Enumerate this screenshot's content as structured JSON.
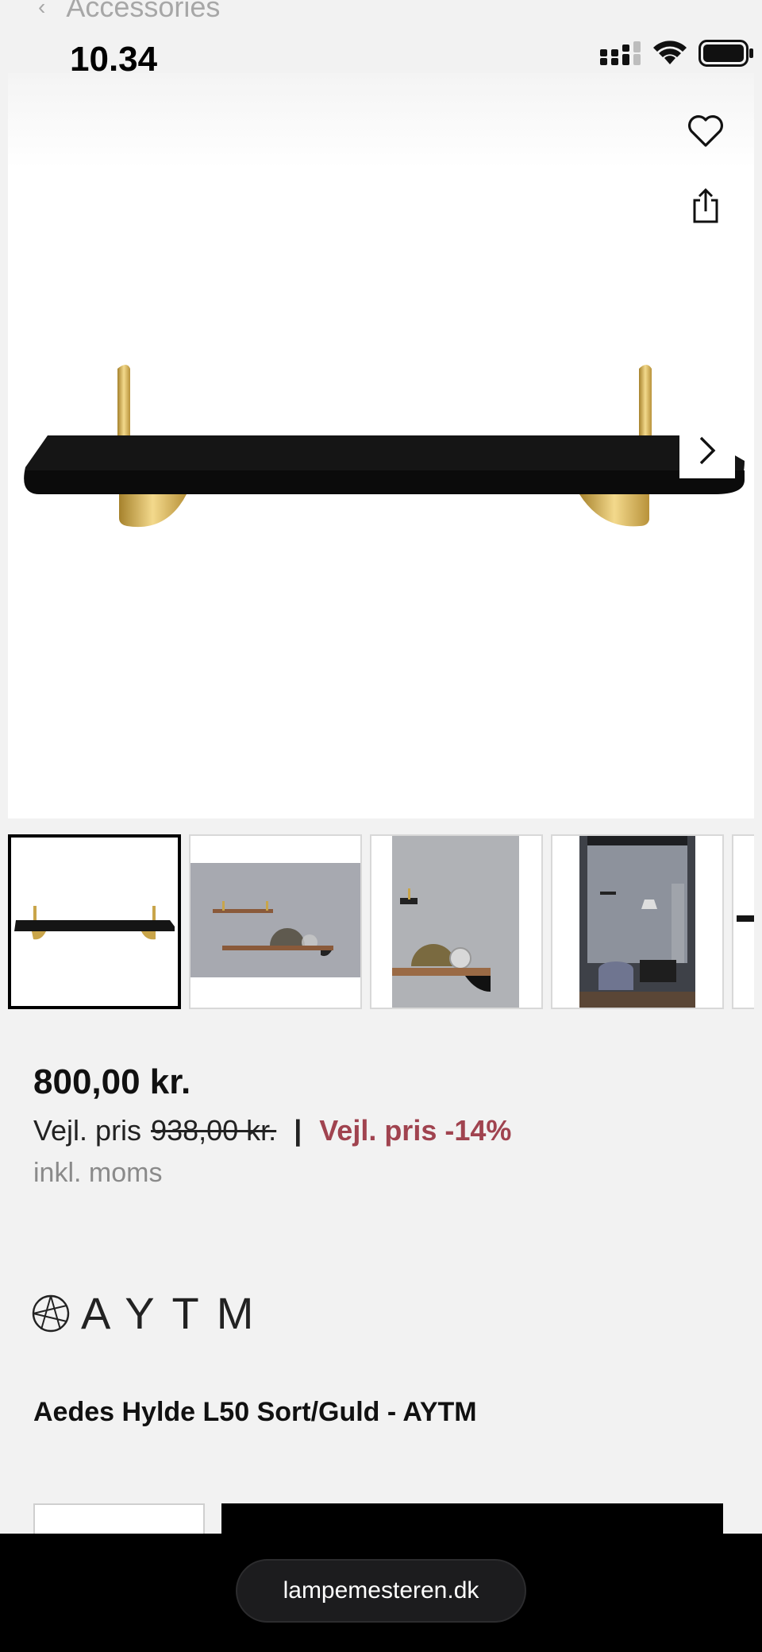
{
  "breadcrumb": {
    "back_glyph": "‹",
    "label": "Accessories"
  },
  "status_bar": {
    "time": "10.34",
    "icons": [
      "signal-icon",
      "wifi-icon",
      "battery-icon"
    ]
  },
  "product": {
    "price": "800,00 kr.",
    "ref_prefix": "Vejl. pris",
    "ref_old_price": "938,00 kr.",
    "separator": "|",
    "discount_text": "Vejl. pris -14%",
    "vat_note": "inkl. moms",
    "brand": "AYTM",
    "title": "Aedes Hylde L50 Sort/Guld - AYTM"
  },
  "gallery": {
    "selected_index": 0,
    "thumbnails": [
      {
        "name": "thumb-shelf-white"
      },
      {
        "name": "thumb-shelves-wall"
      },
      {
        "name": "thumb-shelf-closeup"
      },
      {
        "name": "thumb-room-scene"
      },
      {
        "name": "thumb-partial"
      }
    ]
  },
  "browser": {
    "url": "lampemesteren.dk"
  },
  "colors": {
    "discount": "#a0434f",
    "background": "#f2f2f2",
    "button": "#000000"
  }
}
